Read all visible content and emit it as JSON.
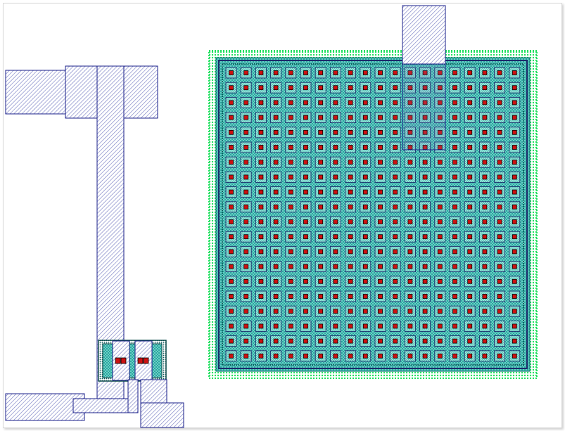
{
  "layout_view": {
    "layers": {
      "metal": {
        "fill_color": "#7a80c4",
        "outline_color": "#1a1f8a",
        "pattern": "diagonal-hatch"
      },
      "active": {
        "fill_color": "#18b8b0",
        "outline_color": "#006666",
        "pattern": "cross-hatch"
      },
      "well_ring": {
        "color": "#22e060",
        "pattern": "dotted"
      },
      "contact": {
        "fill_color": "#cc1111",
        "outline_color": "#000000"
      },
      "inner_ring": {
        "color": "#1a2a6a"
      }
    },
    "contact_array": {
      "rows": 20,
      "columns": 20
    },
    "small_contact_group": {
      "contacts": 4
    }
  }
}
